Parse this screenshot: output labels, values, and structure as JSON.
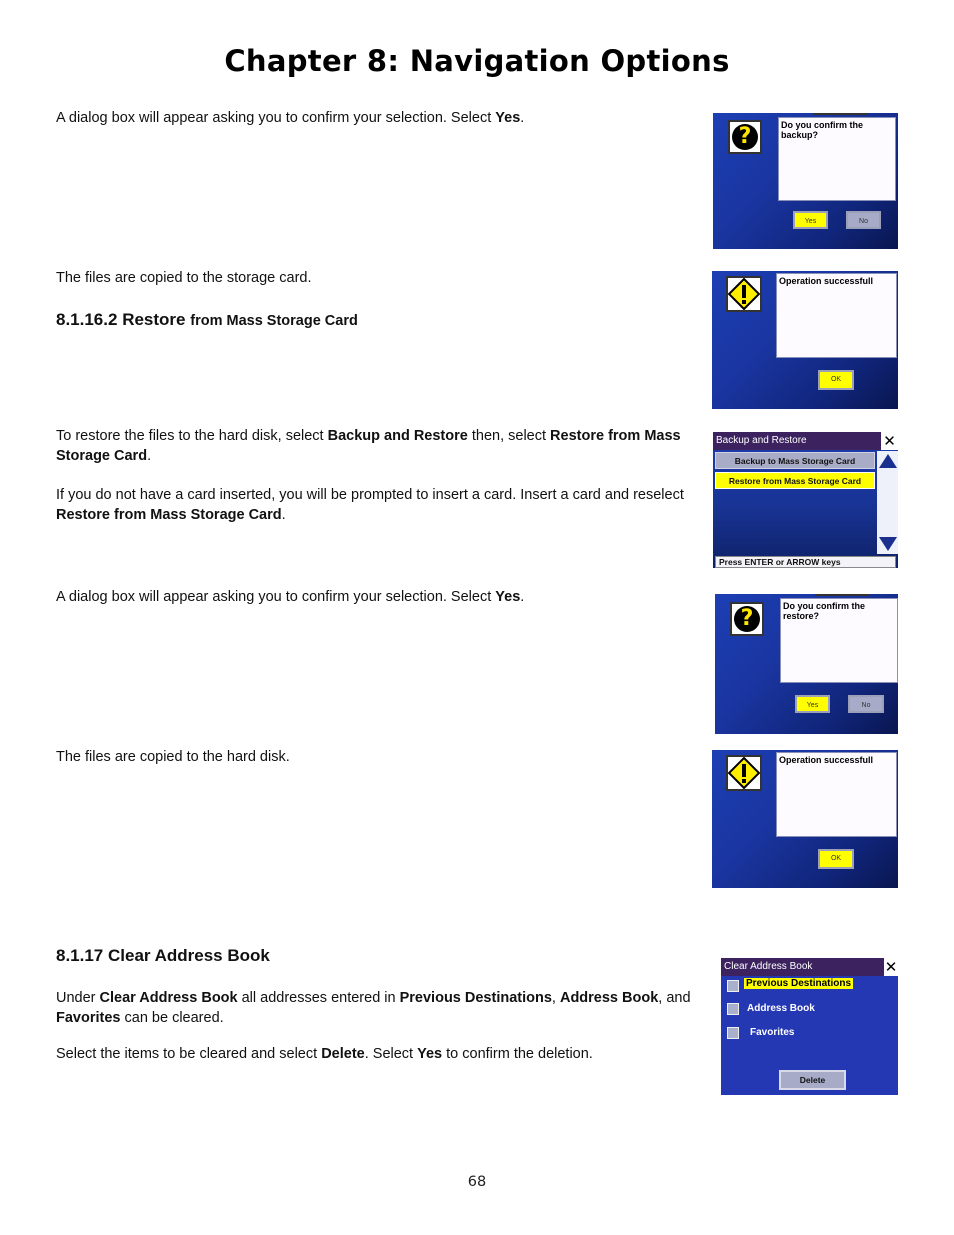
{
  "page": {
    "chapter_title": "Chapter 8: Navigation Options",
    "page_number": "68"
  },
  "sections": {
    "p1": {
      "pre": "A dialog box will appear asking you to confirm your selection. Select ",
      "bold": "Yes",
      "post": "."
    },
    "p2": "The files are copied to the storage card.",
    "restore_heading": {
      "number": "8.1.16.2",
      "word": "Restore",
      "rest": "from Mass Storage Card"
    },
    "p3": {
      "t1": "To restore the files to the hard disk, select ",
      "b1": "Backup and Restore",
      "t2": " then, select ",
      "b2": "Restore from Mass Storage Card",
      "t3": "."
    },
    "p4": {
      "t1": "If you do not have a card inserted, you will be prompted to insert a card. Insert a card and reselect ",
      "b1": "Restore from Mass Storage Card",
      "t2": "."
    },
    "p5": {
      "pre": "A dialog box will appear asking you to confirm your selection. Select ",
      "bold": "Yes",
      "post": "."
    },
    "p6": "The files are copied to the hard disk.",
    "clear_heading": "8.1.17 Clear Address Book",
    "p7": {
      "t1": "Under ",
      "b1": "Clear Address Book",
      "t2": " all addresses entered in ",
      "b2": "Previous Destinations",
      "t3": ", ",
      "b3": "Address Book",
      "t4": ", and ",
      "b4": "Favorites",
      "t5": " can be cleared."
    },
    "p8": {
      "t1": "Select the items to be cleared and select ",
      "b1": "Delete",
      "t2": ".  Select ",
      "b2": "Yes",
      "t3": " to confirm the deletion."
    }
  },
  "screens": {
    "confirm_backup": {
      "message": "Do you confirm the backup?",
      "yes": "Yes",
      "no": "No",
      "icon": "question-icon"
    },
    "success_1": {
      "message": "Operation successfull",
      "ok": "OK",
      "icon": "warning-icon"
    },
    "backup_restore_menu": {
      "title": "Backup and Restore",
      "items": [
        "Backup to Mass Storage Card",
        "Restore from Mass Storage Card"
      ],
      "selected_index": 1,
      "status": "Press ENTER or ARROW keys"
    },
    "confirm_restore": {
      "message": "Do you confirm the restore?",
      "yes": "Yes",
      "no": "No",
      "icon": "question-icon"
    },
    "success_2": {
      "message": "Operation successfull",
      "ok": "OK",
      "icon": "warning-icon"
    },
    "clear_address_book": {
      "title": "Clear Address Book",
      "options": [
        "Previous Destinations",
        "Address Book",
        "Favorites"
      ],
      "highlighted_index": 0,
      "delete": "Delete"
    }
  },
  "colors": {
    "highlight": "#ffff00",
    "screen_blue": "#1c3fb4",
    "titlebar": "#3c2360"
  }
}
